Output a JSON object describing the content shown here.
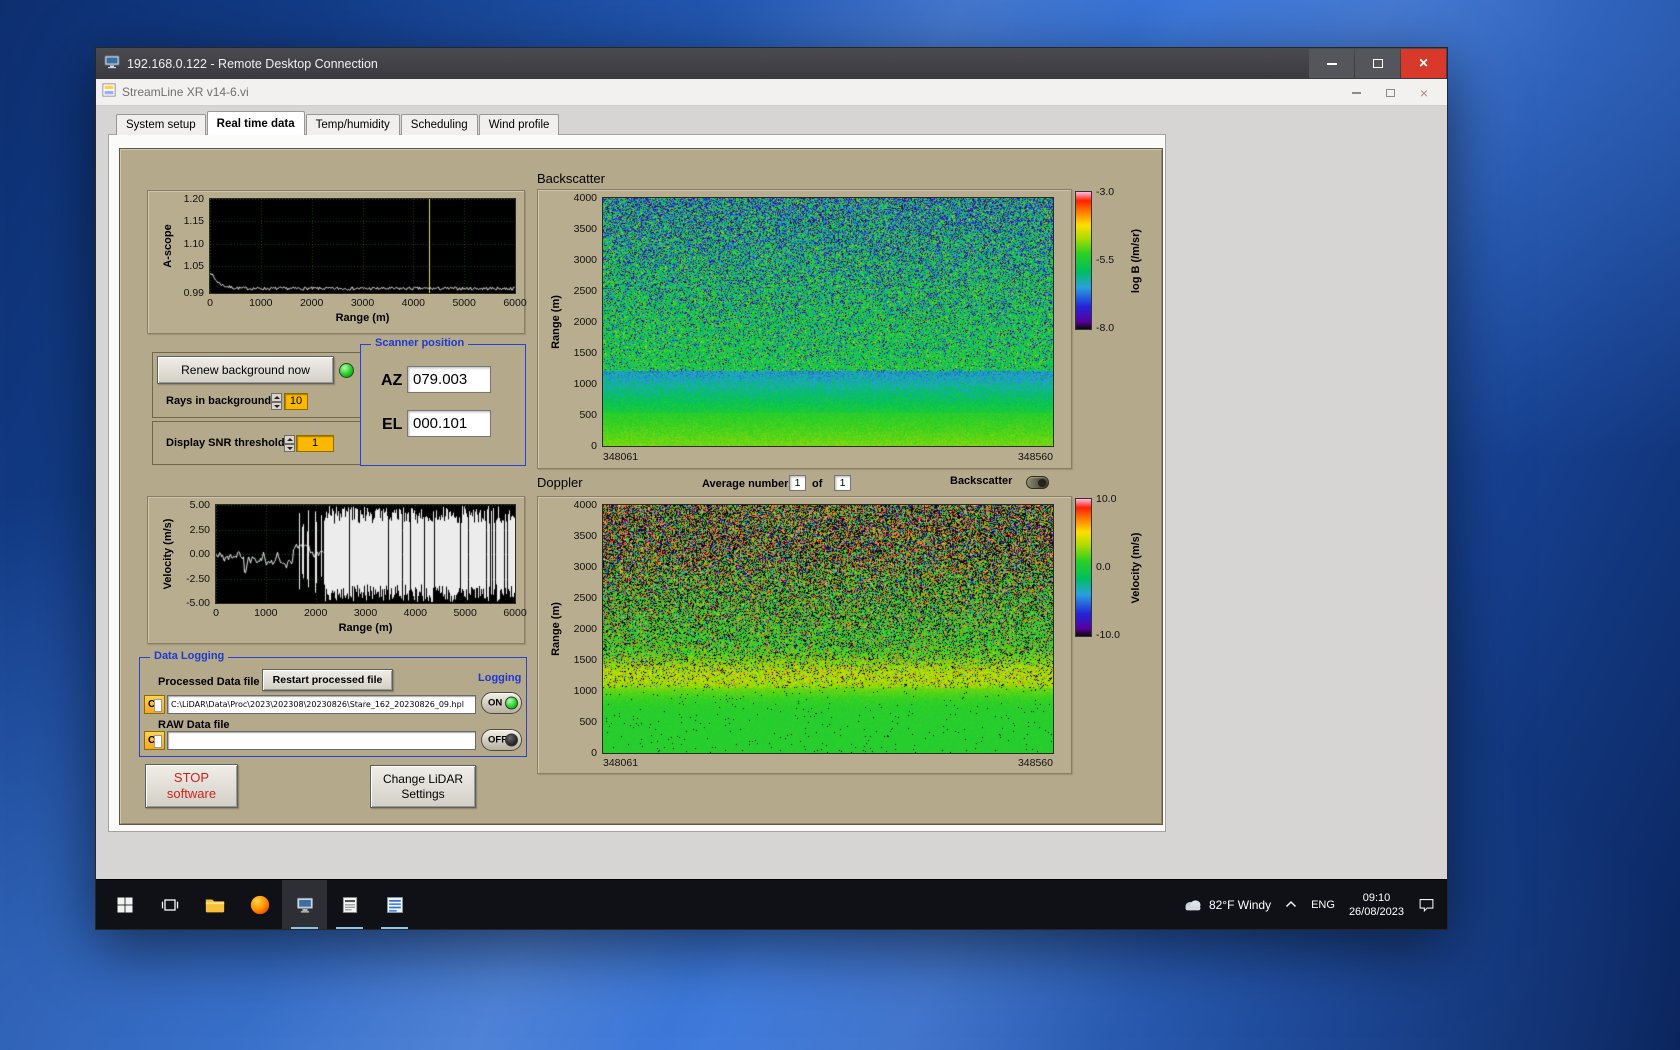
{
  "rdp": {
    "title": "192.168.0.122 - Remote Desktop Connection"
  },
  "app": {
    "title": "StreamLine XR v14-6.vi",
    "tabs": [
      "System setup",
      "Real time data",
      "Temp/humidity",
      "Scheduling",
      "Wind profile"
    ],
    "active_tab": "Real time data"
  },
  "controls": {
    "renew_button": "Renew background now",
    "rays_label": "Rays in background",
    "rays_value": "10",
    "snr_label": "Display SNR threshold",
    "snr_value": "1",
    "scanner": {
      "title": "Scanner position",
      "az_label": "AZ",
      "az_value": "079.003",
      "el_label": "EL",
      "el_value": "000.101"
    },
    "average": {
      "label": "Average number",
      "value": "1",
      "of_label": "of",
      "total": "1"
    },
    "backscatter_toggle_label": "Backscatter",
    "logging": {
      "title": "Data Logging",
      "processed_label": "Processed Data file",
      "restart_button": "Restart processed file",
      "logging_label": "Logging",
      "drive_letter": "C",
      "processed_path": "C:\\LiDAR\\Data\\Proc\\2023\\202308\\20230826\\Stare_162_20230826_09.hpl",
      "raw_label": "RAW Data file",
      "raw_path": "",
      "on_label": "ON",
      "off_label": "OFF"
    },
    "stop_button": [
      "STOP",
      "software"
    ],
    "change_button": [
      "Change LiDAR",
      "Settings"
    ]
  },
  "taskbar": {
    "weather": "82°F Windy",
    "language": "ENG",
    "time": "09:10",
    "date": "26/08/2023"
  },
  "chart_data": [
    {
      "id": "ascope",
      "type": "line",
      "ylabel": "A-scope",
      "xlabel": "Range (m)",
      "ylim": [
        0.99,
        1.2
      ],
      "yticks": [
        "1.20",
        "1.15",
        "1.10",
        "1.05",
        "0.99"
      ],
      "xlim": [
        0,
        6000
      ],
      "xticks": [
        "0",
        "1000",
        "2000",
        "3000",
        "4000",
        "5000",
        "6000"
      ],
      "cursor_x": 4300,
      "trace_color": "#ececec",
      "cursor_color": "#e0e040",
      "bg": "#000000"
    },
    {
      "id": "backscatter",
      "type": "heatmap",
      "title": "Backscatter",
      "ylabel": "Range (m)",
      "ylim": [
        0,
        4000
      ],
      "yticks": [
        "4000",
        "3500",
        "3000",
        "2500",
        "2000",
        "1500",
        "1000",
        "500",
        "0"
      ],
      "xticks": [
        "348061",
        "348560"
      ],
      "colorbar": {
        "label": "log B (/m/sr)",
        "ticks": [
          "-3.0",
          "-5.5",
          "-8.0"
        ],
        "lim": [
          -8,
          -3
        ],
        "stops": [
          [
            0.0,
            "#0d0d0d"
          ],
          [
            0.05,
            "#5a00a0"
          ],
          [
            0.16,
            "#2424d8"
          ],
          [
            0.3,
            "#2aa0e0"
          ],
          [
            0.42,
            "#00c060"
          ],
          [
            0.55,
            "#2ed024"
          ],
          [
            0.66,
            "#aadc00"
          ],
          [
            0.76,
            "#ffdf00"
          ],
          [
            0.86,
            "#ff7a00"
          ],
          [
            0.94,
            "#ff2000"
          ],
          [
            1.0,
            "#ffb4d8"
          ]
        ]
      }
    },
    {
      "id": "velocity",
      "type": "line",
      "ylabel": "Velocity (m/s)",
      "xlabel": "Range (m)",
      "ylim": [
        -5,
        5
      ],
      "yticks": [
        "5.00",
        "2.50",
        "0.00",
        "-2.50",
        "-5.00"
      ],
      "xlim": [
        0,
        6000
      ],
      "xticks": [
        "0",
        "1000",
        "2000",
        "3000",
        "4000",
        "5000",
        "6000"
      ],
      "trace_color": "#ececec",
      "bg": "#000000"
    },
    {
      "id": "doppler",
      "type": "heatmap",
      "title": "Doppler",
      "ylabel": "Range (m)",
      "ylim": [
        0,
        4000
      ],
      "yticks": [
        "4000",
        "3500",
        "3000",
        "2500",
        "2000",
        "1500",
        "1000",
        "500",
        "0"
      ],
      "xticks": [
        "348061",
        "348560"
      ],
      "colorbar": {
        "label": "Velocity (m/s)",
        "ticks": [
          "10.0",
          "0.0",
          "-10.0"
        ],
        "lim": [
          -10,
          10
        ],
        "stops": [
          [
            0.0,
            "#0d0d0d"
          ],
          [
            0.05,
            "#5a00a0"
          ],
          [
            0.16,
            "#2424d8"
          ],
          [
            0.3,
            "#2aa0e0"
          ],
          [
            0.42,
            "#00c060"
          ],
          [
            0.55,
            "#2ed024"
          ],
          [
            0.66,
            "#aadc00"
          ],
          [
            0.76,
            "#ffdf00"
          ],
          [
            0.86,
            "#ff7a00"
          ],
          [
            0.94,
            "#ff2000"
          ],
          [
            1.0,
            "#ffb4d8"
          ]
        ]
      }
    }
  ]
}
